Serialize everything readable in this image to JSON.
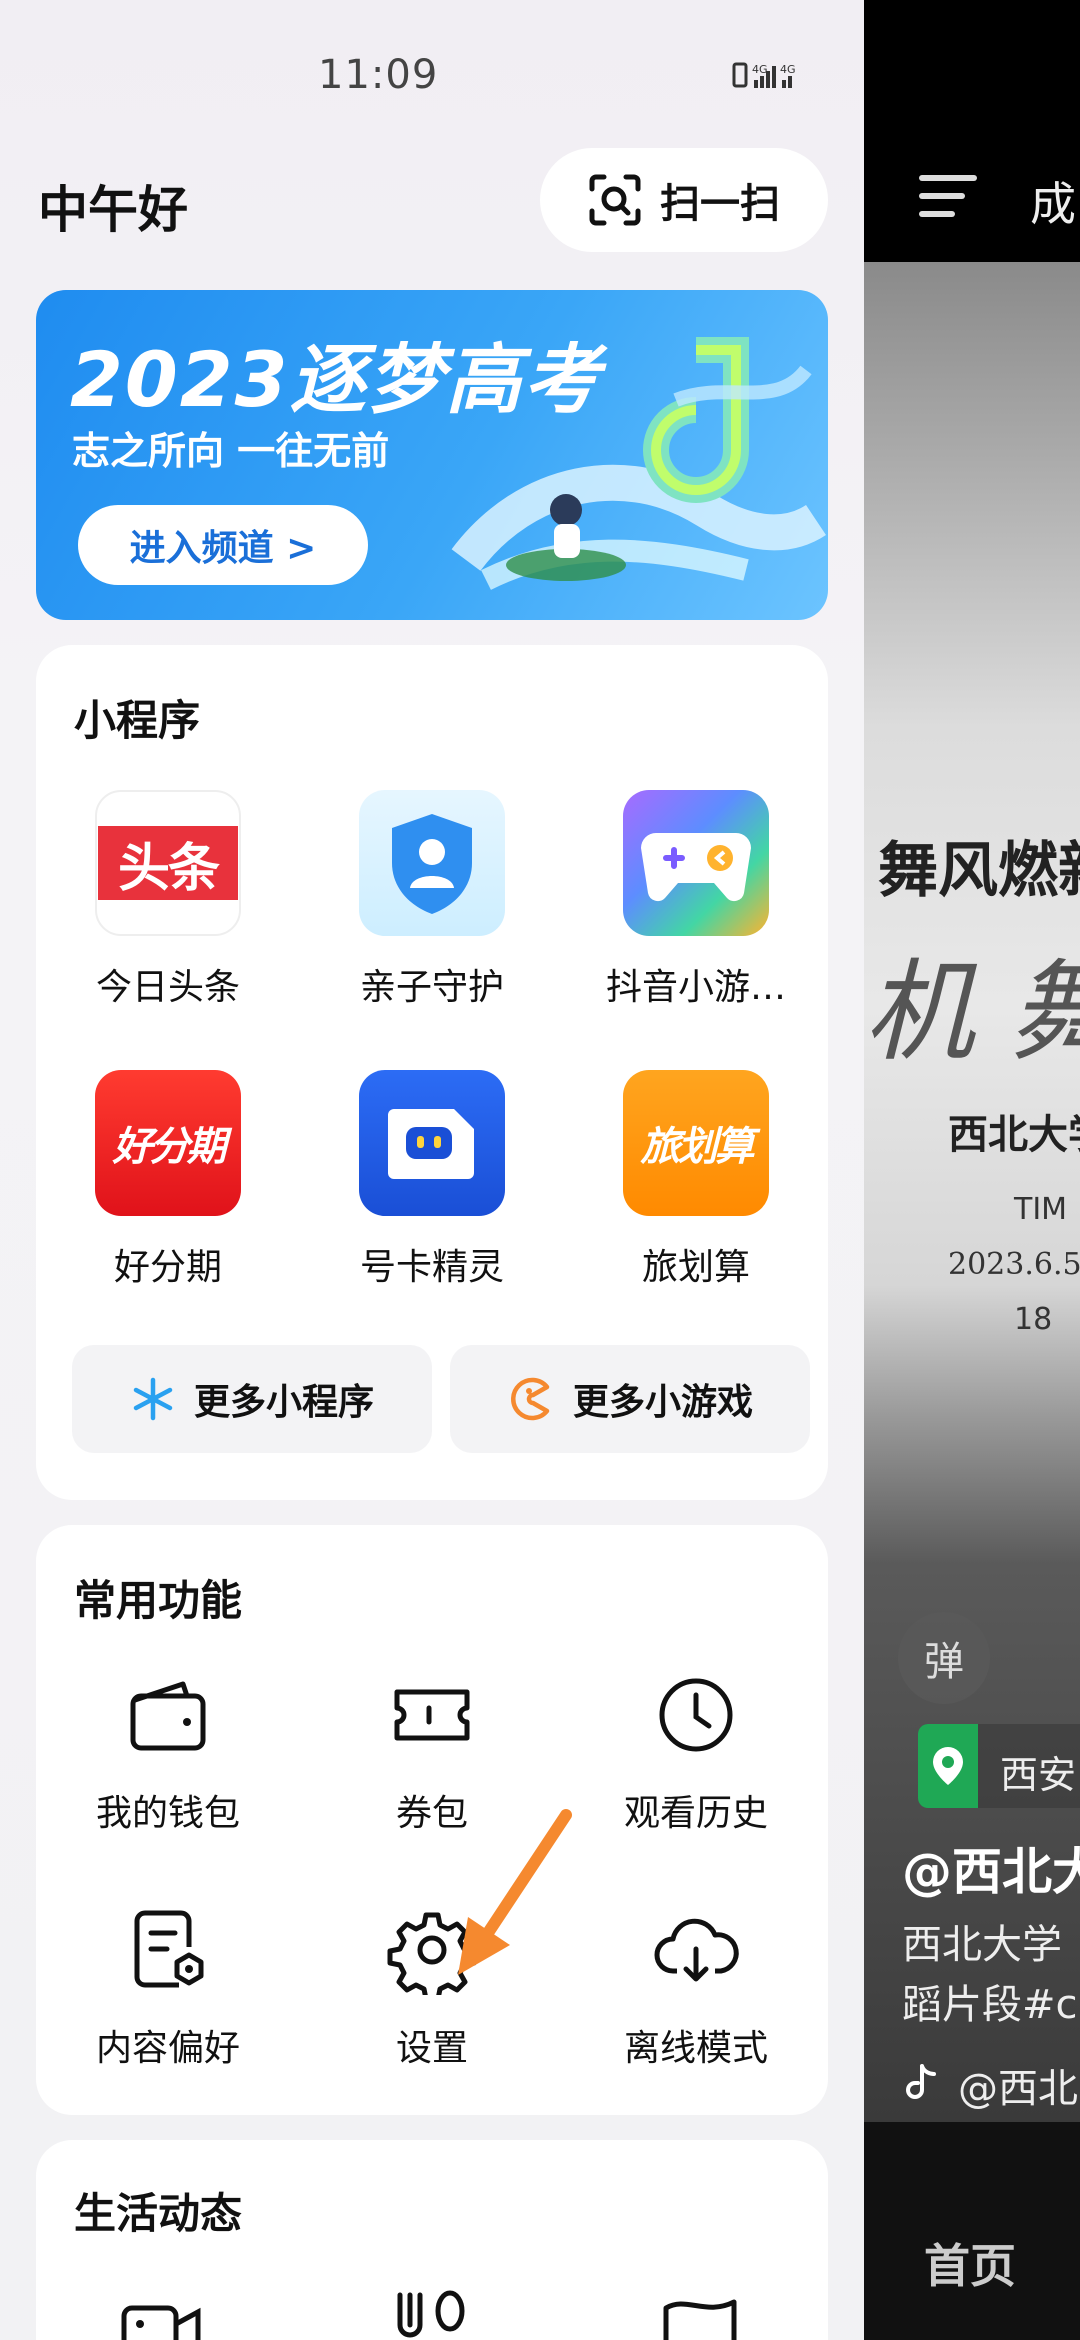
{
  "status_bar": {
    "time": "11:09",
    "signal_text": "4G 4G"
  },
  "header": {
    "greeting": "中午好",
    "scan_label": "扫一扫"
  },
  "banner": {
    "title": "2023逐梦高考",
    "subtitle": "志之所向 一往无前",
    "button": "进入频道 >"
  },
  "mini_programs": {
    "title": "小程序",
    "items": [
      {
        "label": "今日头条",
        "icon": "toutiao-icon",
        "icon_text": "头条"
      },
      {
        "label": "亲子守护",
        "icon": "parental-guard-icon"
      },
      {
        "label": "抖音小游…",
        "icon": "game-controller-icon"
      },
      {
        "label": "好分期",
        "icon": "haofenqi-icon",
        "icon_text": "好分期"
      },
      {
        "label": "号卡精灵",
        "icon": "sim-card-robot-icon"
      },
      {
        "label": "旅划算",
        "icon": "lvhuasuan-icon",
        "icon_text": "旅划算"
      }
    ],
    "more_programs": "更多小程序",
    "more_games": "更多小游戏"
  },
  "common_functions": {
    "title": "常用功能",
    "items": [
      {
        "label": "我的钱包",
        "icon": "wallet-icon"
      },
      {
        "label": "券包",
        "icon": "ticket-icon"
      },
      {
        "label": "观看历史",
        "icon": "clock-icon"
      },
      {
        "label": "内容偏好",
        "icon": "content-preference-icon"
      },
      {
        "label": "设置",
        "icon": "gear-icon"
      },
      {
        "label": "离线模式",
        "icon": "cloud-download-icon"
      }
    ]
  },
  "life": {
    "title": "生活动态"
  },
  "video_peek": {
    "top_text": "成",
    "poster_line1": "舞风燃新",
    "poster_line2": "机 舞",
    "poster_line3": "西北大学",
    "poster_line4": "TIM",
    "poster_line5": "2023.6.5",
    "poster_line6": "18",
    "danmaku": "弹",
    "location": "西安",
    "author": "@西北大",
    "desc_line1": "西北大学",
    "desc_line2": "蹈片段#c",
    "music": "@西北",
    "nav_home": "首页"
  },
  "colors": {
    "accent_orange": "#f5892f",
    "banner_blue": "#2a97f2",
    "location_green": "#1fa855"
  }
}
